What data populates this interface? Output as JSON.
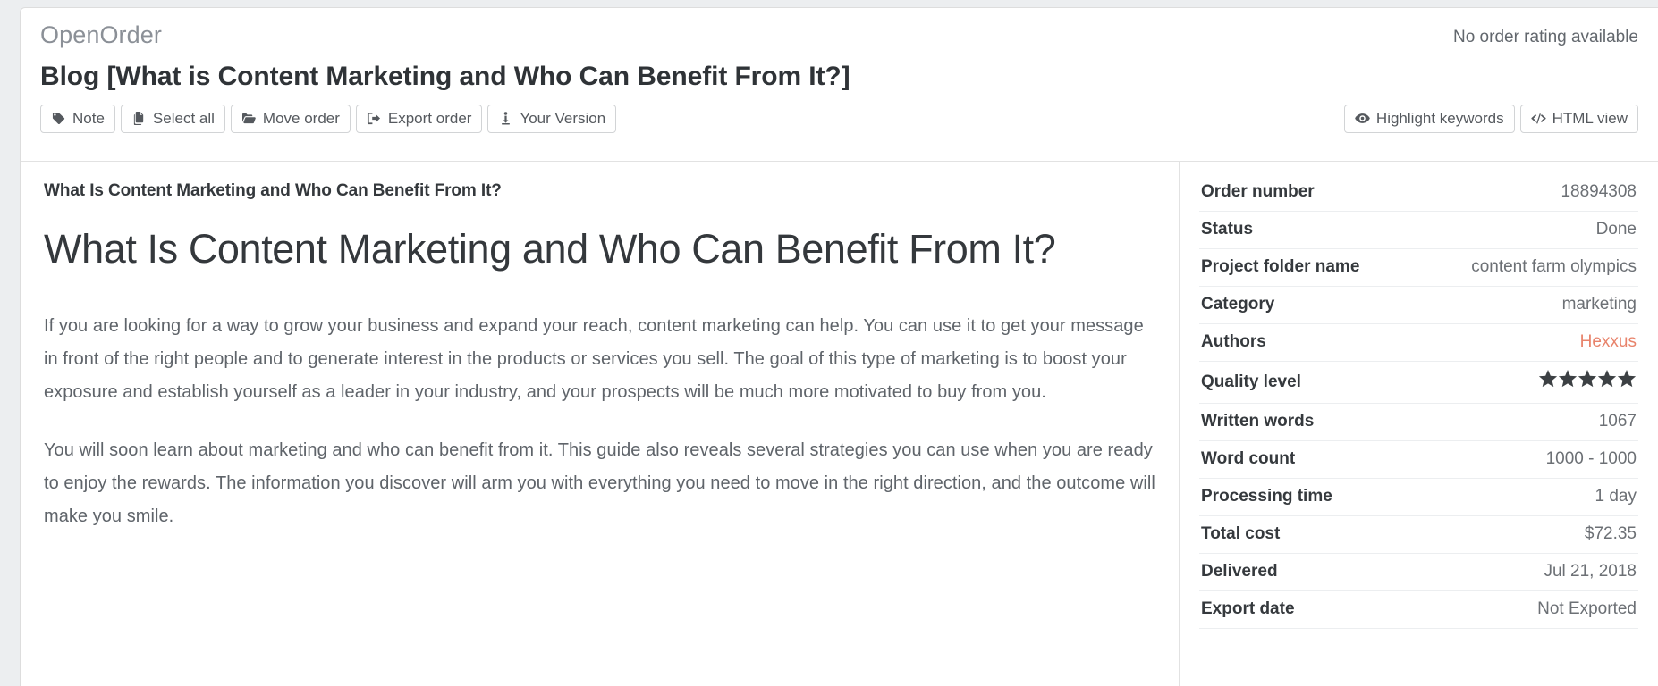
{
  "header": {
    "brand": "OpenOrder",
    "order_rating": "No order rating available",
    "page_title": "Blog [What is Content Marketing and Who Can Benefit From It?]"
  },
  "toolbar": {
    "left_buttons": [
      {
        "label": "Note",
        "icon": "tag-icon"
      },
      {
        "label": "Select all",
        "icon": "copy-files-icon"
      },
      {
        "label": "Move order",
        "icon": "open-folder-icon"
      },
      {
        "label": "Export order",
        "icon": "sign-out-icon"
      },
      {
        "label": "Your Version",
        "icon": "download-person-icon"
      }
    ],
    "right_buttons": [
      {
        "label": "Highlight keywords",
        "icon": "eye-icon"
      },
      {
        "label": "HTML view",
        "icon": "code-icon"
      }
    ]
  },
  "content": {
    "subtitle": "What Is Content Marketing and Who Can Benefit From It?",
    "heading": "What Is Content Marketing and Who Can Benefit From It?",
    "paragraphs": [
      "If you are looking for a way to grow your business and expand your reach, content marketing can help. You can use it to get your message in front of the right people and to generate interest in the products or services you sell. The goal of this type of marketing is to boost your exposure and establish yourself as a leader in your industry, and your prospects will be much more motivated to buy from you.",
      "You will soon learn about marketing and who can benefit from it. This guide also reveals several strategies you can use when you are ready to enjoy the rewards. The information you discover will arm you with everything you need to move in the right direction, and the outcome will make you smile."
    ]
  },
  "sidebar": {
    "rows": [
      {
        "key": "Order number",
        "value": "18894308",
        "type": "text"
      },
      {
        "key": "Status",
        "value": "Done",
        "type": "text"
      },
      {
        "key": "Project folder name",
        "value": "content farm olympics",
        "type": "text"
      },
      {
        "key": "Category",
        "value": "marketing",
        "type": "text"
      },
      {
        "key": "Authors",
        "value": "Hexxus",
        "type": "link"
      },
      {
        "key": "Quality level",
        "value": "5",
        "type": "stars"
      },
      {
        "key": "Written words",
        "value": "1067",
        "type": "text"
      },
      {
        "key": "Word count",
        "value": "1000 - 1000",
        "type": "text"
      },
      {
        "key": "Processing time",
        "value": "1 day",
        "type": "text"
      },
      {
        "key": "Total cost",
        "value": "$72.35",
        "type": "text"
      },
      {
        "key": "Delivered",
        "value": "Jul 21, 2018",
        "type": "text"
      },
      {
        "key": "Export date",
        "value": "Not Exported",
        "type": "text"
      }
    ]
  },
  "colors": {
    "accent_link": "#e8836b",
    "brand_text": "#8b9097",
    "body_text": "#5f646a",
    "heading_text": "#34383c",
    "star_fill": "#3c4043",
    "border": "#e2e2e2",
    "page_background": "#eceef0"
  }
}
